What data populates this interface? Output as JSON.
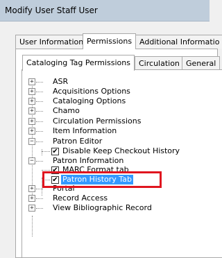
{
  "window": {
    "title": "Modify User Staff User"
  },
  "outer_tabs": [
    {
      "label": "User Information",
      "active": false
    },
    {
      "label": "Permissions",
      "active": true
    },
    {
      "label": "Additional Informatio",
      "active": false
    }
  ],
  "inner_tabs": [
    {
      "label": "Cataloging Tag Permissions",
      "active": true
    },
    {
      "label": "Circulation",
      "active": false
    },
    {
      "label": "General",
      "active": false
    }
  ],
  "tree": {
    "nodes": [
      {
        "label": "ASR",
        "expander": "+"
      },
      {
        "label": "Acquisitions Options",
        "expander": "+"
      },
      {
        "label": "Cataloging Options",
        "expander": "+"
      },
      {
        "label": "Chamo",
        "expander": "+"
      },
      {
        "label": "Circulation Permissions",
        "expander": "+"
      },
      {
        "label": "Item Information",
        "expander": "+"
      },
      {
        "label": "Patron Editor",
        "expander": "−"
      },
      {
        "label": "Disable Keep Checkout History",
        "checked": true
      },
      {
        "label": "Patron Information",
        "expander": "−"
      },
      {
        "label": "MARC Format tab",
        "checked": true
      },
      {
        "label": "Patron History Tab",
        "checked": true,
        "selected": true
      },
      {
        "label": "Portal",
        "expander": "+"
      },
      {
        "label": "Record Access",
        "expander": "+"
      },
      {
        "label": "View Bibliographic Record",
        "expander": "+"
      }
    ]
  },
  "colors": {
    "selection": "#3399ff",
    "annotation_box": "#e0151f",
    "titlebar": "#bfcddb"
  },
  "icons": {
    "expand": "plus-box-icon",
    "collapse": "minus-box-icon",
    "check": "checkmark-icon"
  }
}
